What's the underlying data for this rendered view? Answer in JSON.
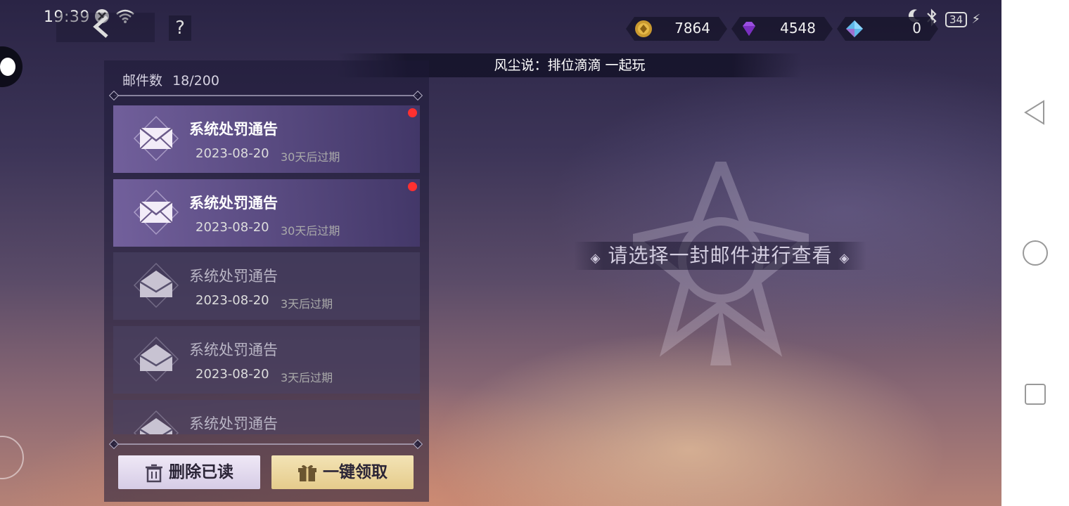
{
  "status_bar": {
    "time": "19:39",
    "battery": "34"
  },
  "header": {
    "currencies": [
      {
        "icon": "gold-coin-icon",
        "value": "7864"
      },
      {
        "icon": "purple-diamond-icon",
        "value": "4548"
      },
      {
        "icon": "blue-crystal-icon",
        "value": "0"
      }
    ],
    "notice": "风尘说：排位滴滴 一起玩"
  },
  "mail_panel": {
    "count_label": "邮件数",
    "count_value": "18/200",
    "mails": [
      {
        "title": "系统处罚通告",
        "date": "2023-08-20",
        "expiry": "30天后过期",
        "unread": true
      },
      {
        "title": "系统处罚通告",
        "date": "2023-08-20",
        "expiry": "30天后过期",
        "unread": true
      },
      {
        "title": "系统处罚通告",
        "date": "2023-08-20",
        "expiry": "3天后过期",
        "unread": false
      },
      {
        "title": "系统处罚通告",
        "date": "2023-08-20",
        "expiry": "3天后过期",
        "unread": false
      },
      {
        "title": "系统处罚通告",
        "date": "",
        "expiry": "",
        "unread": false
      }
    ],
    "delete_read_label": "删除已读",
    "claim_all_label": "一键领取"
  },
  "content": {
    "placeholder": "请选择一封邮件进行查看"
  },
  "colors": {
    "unread_dot": "#ff3030",
    "claim_button": "#e5cc8c",
    "delete_button": "#d6cce6"
  }
}
